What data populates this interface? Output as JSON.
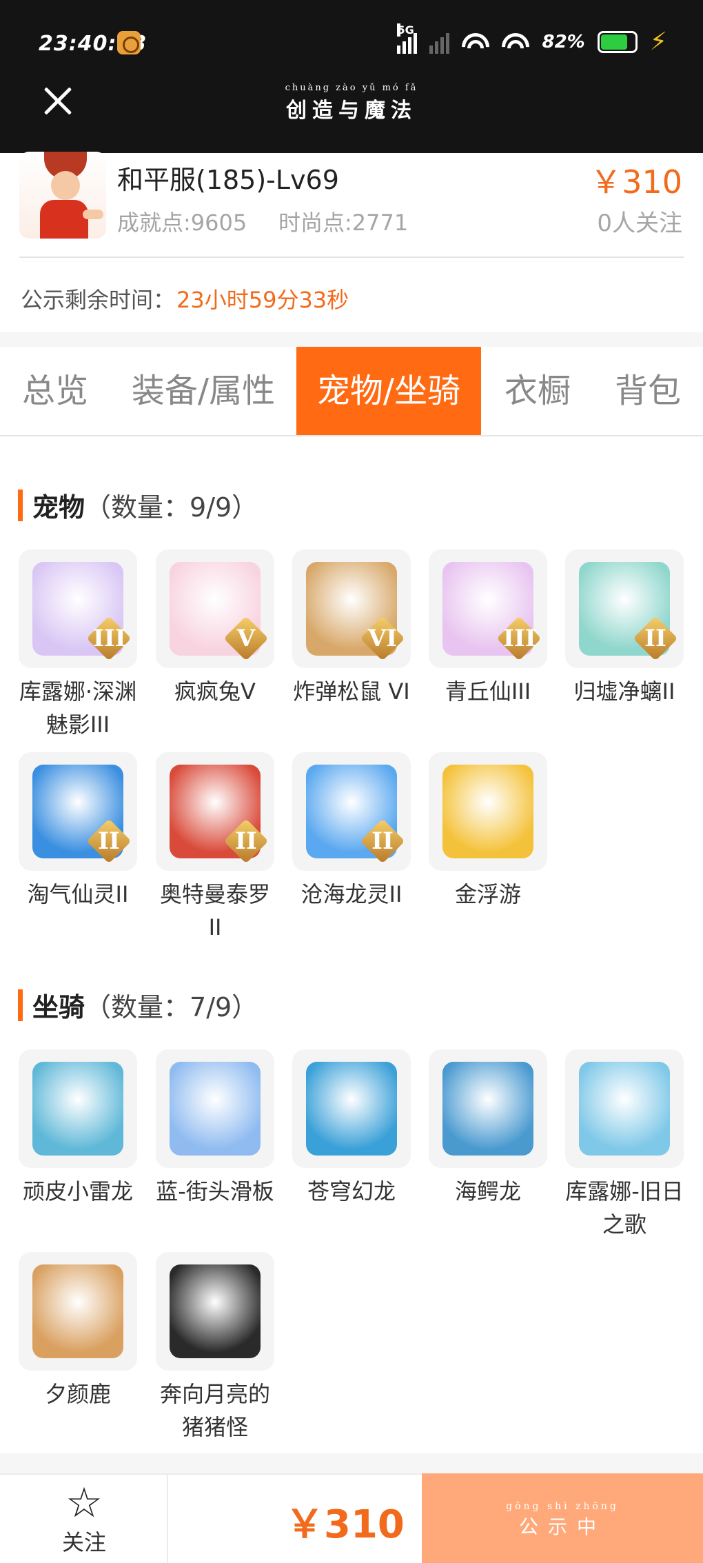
{
  "status_bar": {
    "time": "23:40:53",
    "network": "5G",
    "battery_percent": "82%",
    "battery_level": 0.82
  },
  "header": {
    "title_pinyin": "chuàng zào yǔ mó fǎ",
    "title": "创造与魔法"
  },
  "character": {
    "name": "和平服(185)-Lv69",
    "achievement": "成就点:9605",
    "fashion": "时尚点:2771",
    "price": "￥310",
    "watchers": "0人关注",
    "notice_label": "公示剩余时间：",
    "notice_time": "23小时59分33秒"
  },
  "tabs": [
    {
      "label": "总览",
      "active": false
    },
    {
      "label": "装备/属性",
      "active": false
    },
    {
      "label": "宠物/坐骑",
      "active": true
    },
    {
      "label": "衣橱",
      "active": false
    },
    {
      "label": "背包",
      "active": false
    }
  ],
  "pets": {
    "title": "宠物",
    "count": "（数量：9/9）",
    "items": [
      {
        "name": "库露娜·深渊魅影III",
        "tier": "III",
        "icon": "pet-kuluna-icon",
        "color": "#d9c6f5"
      },
      {
        "name": "疯疯兔V",
        "tier": "V",
        "icon": "pet-rabbit-icon",
        "color": "#f8d3e0"
      },
      {
        "name": "炸弹松鼠 VI",
        "tier": "VI",
        "icon": "pet-squirrel-icon",
        "color": "#d8a86a"
      },
      {
        "name": "青丘仙III",
        "tier": "III",
        "icon": "pet-fox-fairy-icon",
        "color": "#e8c4f0"
      },
      {
        "name": "归墟净螭II",
        "tier": "II",
        "icon": "pet-dragon-icon",
        "color": "#8fd6cc"
      },
      {
        "name": "淘气仙灵II",
        "tier": "II",
        "icon": "pet-sprite-icon",
        "color": "#3a8fe0"
      },
      {
        "name": "奥特曼泰罗II",
        "tier": "II",
        "icon": "pet-ultraman-icon",
        "color": "#d94a3a"
      },
      {
        "name": "沧海龙灵II",
        "tier": "II",
        "icon": "pet-sea-dragon-icon",
        "color": "#5aa8f0"
      },
      {
        "name": "金浮游",
        "tier": "",
        "icon": "pet-golden-fish-icon",
        "color": "#f4c23a"
      }
    ]
  },
  "mounts": {
    "title": "坐骑",
    "count": "（数量：7/9）",
    "items": [
      {
        "name": "顽皮小雷龙",
        "icon": "mount-thunder-dragon-icon",
        "color": "#5fb8d8"
      },
      {
        "name": "蓝-街头滑板",
        "icon": "mount-skateboard-icon",
        "color": "#8fbbf0"
      },
      {
        "name": "苍穹幻龙",
        "icon": "mount-sky-dragon-icon",
        "color": "#3aa0d8"
      },
      {
        "name": "海鳄龙",
        "icon": "mount-sea-crocodile-icon",
        "color": "#4a9ad0"
      },
      {
        "name": "库露娜-旧日之歌",
        "icon": "mount-kuluna-song-icon",
        "color": "#7fc8e8"
      },
      {
        "name": "夕颜鹿",
        "icon": "mount-deer-icon",
        "color": "#d9a060"
      },
      {
        "name": "奔向月亮的猪猪怪",
        "icon": "mount-moon-pig-icon",
        "color": "#2a2a2a"
      }
    ]
  },
  "bottom": {
    "follow_label": "关注",
    "price": "￥310",
    "status_pinyin": "gōng shì zhōng",
    "status": "公示中"
  },
  "colors": {
    "accent": "#ff6a12",
    "price": "#f26a1b",
    "status_button": "#ffa97a"
  }
}
